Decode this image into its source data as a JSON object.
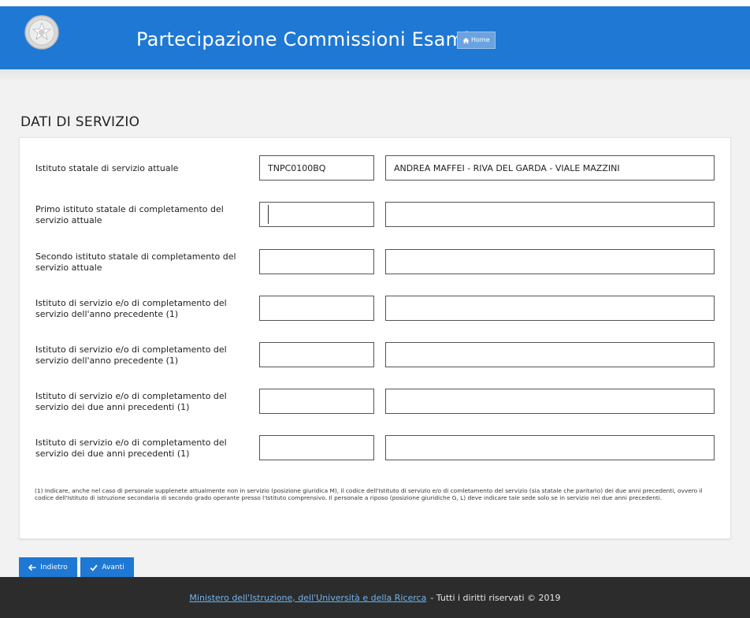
{
  "header": {
    "title": "Partecipazione Commissioni Esami",
    "home_label": "Home",
    "emblem_icon": "italian-republic-emblem-icon",
    "home_icon": "home-icon",
    "bg_color": "#1f78d4"
  },
  "section": {
    "title": "DATI DI SERVIZIO"
  },
  "form": {
    "rows": [
      {
        "label": "Istituto statale di servizio attuale",
        "code": "TNPC0100BQ",
        "name": "ANDREA MAFFEI - RIVA DEL GARDA - VIALE MAZZINI"
      },
      {
        "label": "Primo istituto statale di completamento del servizio attuale",
        "code": "",
        "name": ""
      },
      {
        "label": "Secondo istituto statale di completamento del servizio attuale",
        "code": "",
        "name": ""
      },
      {
        "label": "Istituto di servizio e/o di completamento del servizio dell'anno precedente (1)",
        "code": "",
        "name": ""
      },
      {
        "label": "Istituto di servizio e/o di completamento del servizio dell'anno precedente (1)",
        "code": "",
        "name": ""
      },
      {
        "label": "Istituto di servizio e/o di completamento del servizio dei due anni precedenti (1)",
        "code": "",
        "name": ""
      },
      {
        "label": "Istituto di servizio e/o di completamento del servizio dei due anni precedenti (1)",
        "code": "",
        "name": ""
      }
    ],
    "footnote": "(1) Indicare, anche nel caso di personale supplenete attualmente non in servizio (posizione giuridica M), il codice dell'Istituto di servizio e/o di comletamento del servizio (sia statale che paritario) dei due anni precedenti, ovvero il codice dell'Istituto di istruzione secondaria di secondo grado operante presso l'Istituto comprensivo. Il personale a riposo (posizione giuridiche G, L) deve indicare tale sede solo se in servizio nei due anni precedenti."
  },
  "actions": {
    "back_label": "Indietro",
    "next_label": "Avanti",
    "back_icon": "arrow-left-icon",
    "next_icon": "checkmark-icon"
  },
  "footer": {
    "link_text": "Ministero dell'Istruzione, dell'Università e della Ricerca",
    "rest_text": "- Tutti i diritti riservati © 2019"
  }
}
